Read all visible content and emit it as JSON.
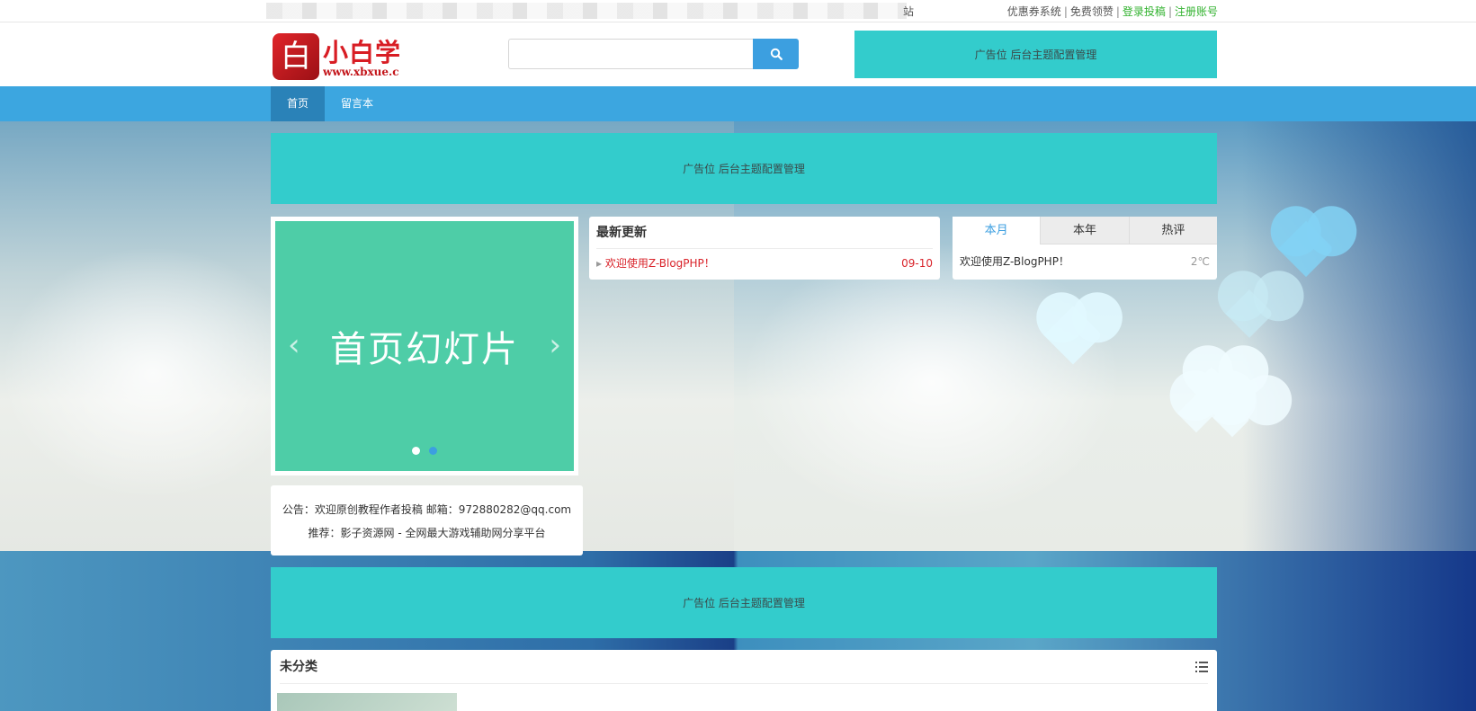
{
  "topbar": {
    "partial_text": "站",
    "links": [
      {
        "label": "优惠券系统",
        "color": "#555555"
      },
      {
        "label": "免费领赞",
        "color": "#555555"
      },
      {
        "label": "登录投稿",
        "color": "#31b22e"
      },
      {
        "label": "注册账号",
        "color": "#31b22e"
      }
    ],
    "separator": "|"
  },
  "header": {
    "logo": {
      "mark": "白",
      "name": "小白学",
      "url": "www.xbxue.c"
    },
    "search": {
      "value": "",
      "placeholder": "",
      "icon": "search-icon"
    },
    "ad": "广告位 后台主题配置管理"
  },
  "nav": {
    "items": [
      {
        "label": "首页",
        "active": true
      },
      {
        "label": "留言本",
        "active": false
      }
    ]
  },
  "ads": {
    "top": "广告位 后台主题配置管理",
    "middle": "广告位 后台主题配置管理"
  },
  "slider": {
    "title": "首页幻灯片",
    "prev": "‹",
    "next": "›",
    "slide_count": 2,
    "active_index": 1
  },
  "notice": {
    "line1": "公告：欢迎原创教程作者投稿 邮箱：972880282@qq.com",
    "line2": "推荐：影子资源网 - 全网最大游戏辅助网分享平台"
  },
  "latest": {
    "title": "最新更新",
    "items": [
      {
        "title": "欢迎使用Z-BlogPHP！",
        "date": "09-10"
      }
    ]
  },
  "rank_tabs": {
    "tabs": [
      {
        "label": "本月",
        "active": true
      },
      {
        "label": "本年",
        "active": false
      },
      {
        "label": "热评",
        "active": false
      }
    ],
    "items": [
      {
        "title": "欢迎使用Z-BlogPHP！",
        "meta": "2℃"
      }
    ]
  },
  "category": {
    "title": "未分类",
    "icon": "list-icon"
  },
  "colors": {
    "accent": "#3ca6e0",
    "nav_active": "#2a82b8",
    "ad_bg": "#33cccc",
    "slide_bg": "#4ecda7",
    "link_red": "#d9232a",
    "link_green": "#31b22e"
  }
}
